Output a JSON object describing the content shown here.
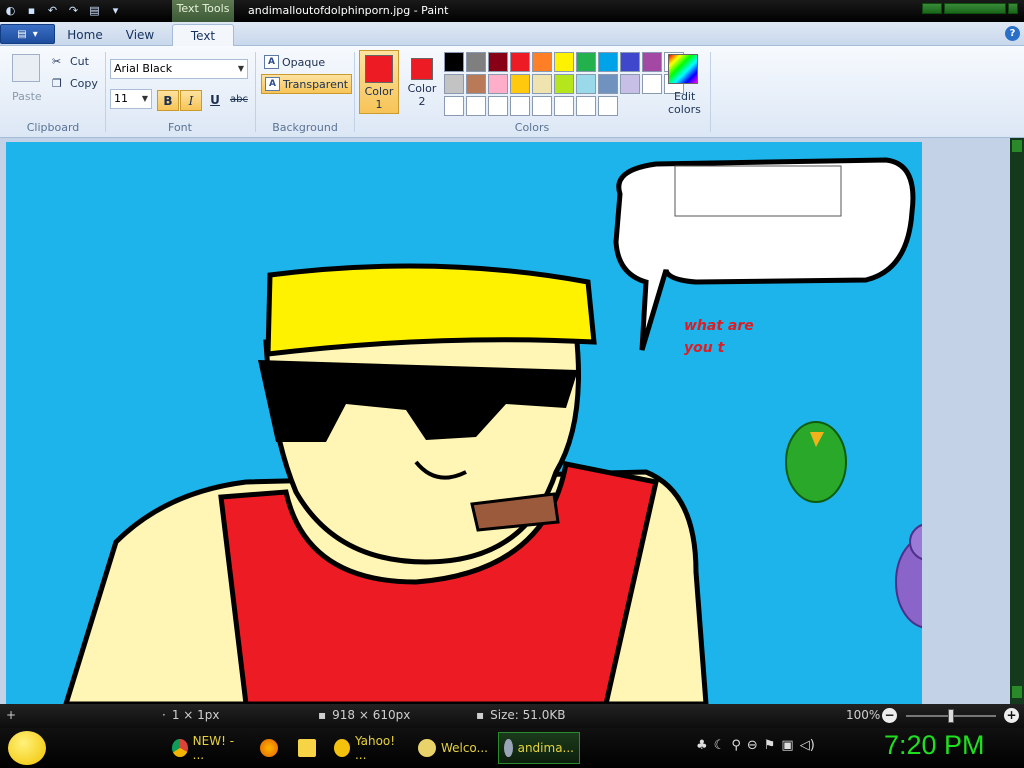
{
  "window": {
    "title": "andimalloutofdolphinporn.jpg - Paint",
    "contextual_tab": "Text Tools"
  },
  "tabs": {
    "home": "Home",
    "view": "View",
    "text": "Text"
  },
  "clipboard": {
    "paste": "Paste",
    "cut": "Cut",
    "copy": "Copy",
    "group": "Clipboard"
  },
  "font": {
    "family": "Arial Black",
    "size": "11",
    "bold": "B",
    "italic": "I",
    "underline": "U",
    "strike": "abc",
    "group": "Font"
  },
  "background": {
    "opaque": "Opaque",
    "transparent": "Transparent",
    "group": "Background"
  },
  "colors": {
    "color1_label_a": "Color",
    "color1_label_b": "1",
    "color2_label_a": "Color",
    "color2_label_b": "2",
    "color1_value": "#ed1c24",
    "color2_value": "#ed1c24",
    "edit_a": "Edit",
    "edit_b": "colors",
    "group": "Colors",
    "palette": [
      "#000000",
      "#7f7f7f",
      "#880015",
      "#ed1c24",
      "#ff7f27",
      "#fff200",
      "#22b14c",
      "#00a2e8",
      "#3f48cc",
      "#a349a4",
      "#ffffff",
      "#c3c3c3",
      "#b97a57",
      "#ffaec9",
      "#ffc90e",
      "#efe4b0",
      "#b5e61d",
      "#99d9ea",
      "#7092be",
      "#c8bfe7",
      "#ffffff",
      "#ffffff",
      "#ffffff",
      "#ffffff",
      "#ffffff",
      "#ffffff",
      "#ffffff",
      "#ffffff",
      "#ffffff",
      "#ffffff"
    ]
  },
  "canvas": {
    "text_line1": "what are",
    "text_line2": "you t"
  },
  "status": {
    "cursor": "1 × 1px",
    "dimensions": "918 × 610px",
    "size": "Size: 51.0KB",
    "zoom": "100%"
  },
  "taskbar": {
    "items": [
      {
        "label": "NEW! - ...",
        "icon": "chrome-icon"
      },
      {
        "label": "",
        "icon": "firefox-icon"
      },
      {
        "label": "",
        "icon": "folder-icon"
      },
      {
        "label": "Yahoo! ...",
        "icon": "yahoo-messenger-icon"
      },
      {
        "label": "Welco...",
        "icon": "banana-icon"
      },
      {
        "label": "andima...",
        "icon": "paint-icon"
      }
    ],
    "clock": "7:20 PM"
  }
}
